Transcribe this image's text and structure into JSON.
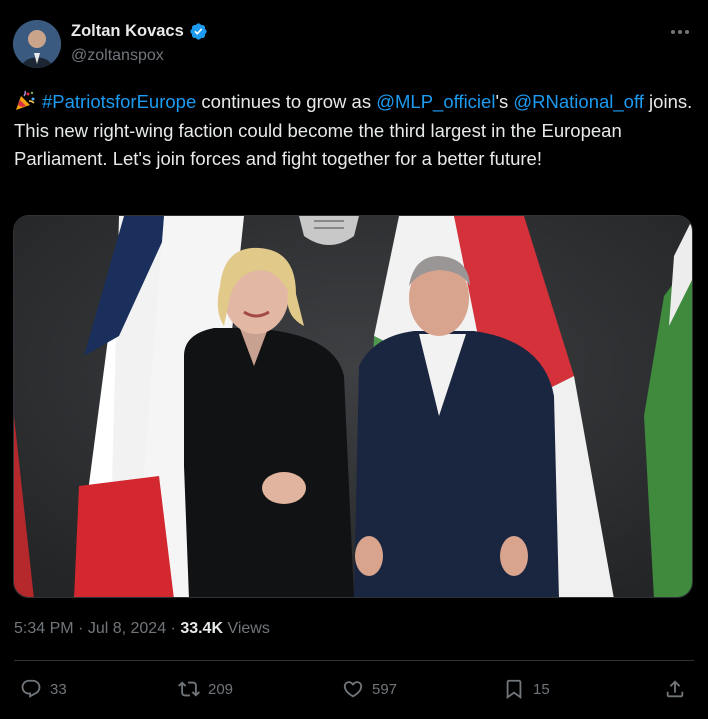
{
  "author": {
    "display_name": "Zoltan Kovacs",
    "handle": "@zoltanspox",
    "verified_icon": "verified-badge-icon"
  },
  "tweet": {
    "emoji": "party-popper",
    "hashtag": "#PatriotsforEurope",
    "t1": " continues to grow as ",
    "mention1": "@MLP_officiel",
    "t2": "'s ",
    "mention2": "@RNational_off",
    "t3": " joins. This new right-wing faction could become the third largest in the European Parliament. Let's join forces and fight together for a better future!"
  },
  "meta": {
    "time": "5:34 PM",
    "sep": " · ",
    "date": "Jul 8, 2024",
    "sep2": " · ",
    "views_count": "33.4K",
    "views_label": " Views"
  },
  "actions": {
    "replies": "33",
    "reposts": "209",
    "likes": "597",
    "bookmarks": "15"
  },
  "colors": {
    "background": "#000000",
    "text": "#e7e9ea",
    "muted": "#71767b",
    "link": "#1d9bf0",
    "border": "#2f3336"
  }
}
